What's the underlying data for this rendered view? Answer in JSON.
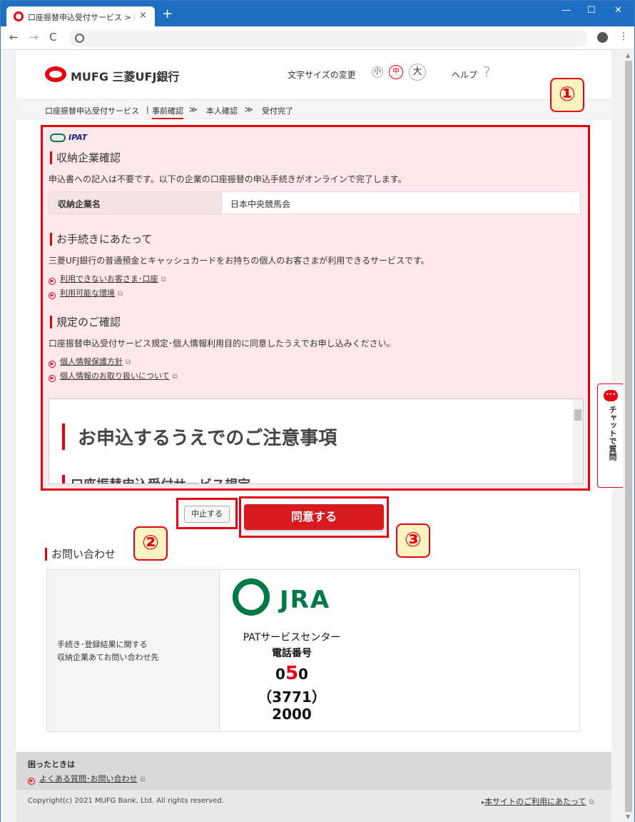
{
  "browser": {
    "tab_title": "口座振替申込受付サービス > 事前確認",
    "close": "×",
    "new_tab": "+",
    "win_min": "—",
    "win_max": "☐",
    "win_close": "✕",
    "back": "←",
    "forward": "→",
    "reload": "C",
    "menu": "⋮"
  },
  "header": {
    "logo": "MUFG  三菱UFJ銀行",
    "font_size_label": "文字サイズの変更",
    "font_small": "小",
    "font_medium": "中",
    "font_large": "大",
    "help": "ヘルプ",
    "help_icon": "?"
  },
  "breadcrumb": {
    "service": "口座振替申込受付サービス",
    "sep1": "|",
    "step1": "事前確認",
    "sep2": "≫",
    "step2": "本人確認",
    "sep3": "≫",
    "step3": "受付完了"
  },
  "main": {
    "ipat_logo": "IPAT",
    "sec1_title": "収納企業確認",
    "sec1_text": "申込書への記入は不要です。以下の企業の口座振替の申込手続きがオンラインで完了します。",
    "company_label": "収納企業名",
    "company_value": "日本中央競馬会",
    "sec2_title": "お手続きにあたって",
    "sec2_text": "三菱UFJ銀行の普通預金とキャッシュカードをお持ちの個人のお客さまが利用できるサービスです。",
    "link1": "利用できないお客さま･口座",
    "link2": "利用可能な環境",
    "sec3_title": "規定のご確認",
    "sec3_text": "口座振替申込受付サービス規定･個人情報利用目的に同意したうえでお申し込みください。",
    "link3": "個人情報保護方針",
    "link4": "個人情報のお取り扱いについて",
    "terms_heading": "お申込するうえでのご注意事項",
    "terms_sub": "口座振替申込受付サービス規定",
    "ext_icon": "⧉"
  },
  "buttons": {
    "cancel": "中止する",
    "agree": "同意する"
  },
  "callouts": {
    "c1": "①",
    "c2": "②",
    "c3": "③"
  },
  "inquiry": {
    "title": "お問い合わせ",
    "label_line1": "手続き･登録結果に関する",
    "label_line2": "収納企業あてお問い合わせ先",
    "jra_logo": "JRA",
    "center": "PATサービスセンター",
    "phone_label": "電話番号",
    "num1_a": "0",
    "num1_b": "5",
    "num1_c": "0",
    "num2": "（3771）",
    "num3": "2000"
  },
  "footer": {
    "trouble": "困ったときは",
    "faq": "よくある質問･お問い合わせ",
    "terms_link": "本サイトのご利用にあたって",
    "copyright": "Copyright(c) 2021 MUFG Bank, Ltd. All rights reserved."
  },
  "chat": {
    "label": "チャットで質問"
  },
  "colors": {
    "brand_red": "#e60012",
    "jra_green": "#007a44",
    "highlight_pink": "#ffe8ec"
  }
}
